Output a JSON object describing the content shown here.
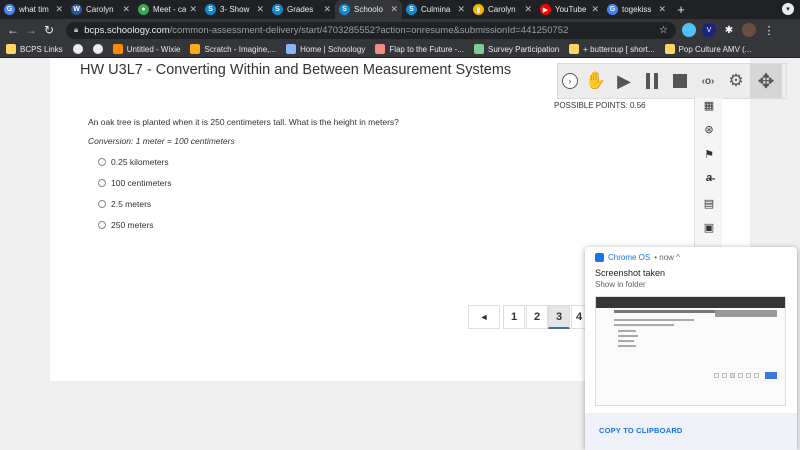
{
  "browser": {
    "tabs": [
      {
        "label": "what tim",
        "favicon": "G",
        "color": "#4285f4"
      },
      {
        "label": "Carolyn",
        "favicon": "W",
        "color": "#2b579a"
      },
      {
        "label": "Meet - ca",
        "favicon": "●",
        "color": "#34a853"
      },
      {
        "label": "3- Show",
        "favicon": "S",
        "color": "#0c8bd1"
      },
      {
        "label": "Grades",
        "favicon": "S",
        "color": "#0c8bd1"
      },
      {
        "label": "Schoolo",
        "favicon": "S",
        "color": "#0c8bd1",
        "active": true
      },
      {
        "label": "Culmina",
        "favicon": "S",
        "color": "#0c8bd1"
      },
      {
        "label": "Carolyn",
        "favicon": "▮",
        "color": "#f4b400"
      },
      {
        "label": "YouTube",
        "favicon": "▶",
        "color": "#ff0000"
      },
      {
        "label": "togekiss",
        "favicon": "G",
        "color": "#4285f4"
      }
    ],
    "new_tab": "+",
    "url_host": "bcps.schoology.com",
    "url_path": "/common-assessment-delivery/start/4703285552?action=onresume&submissionId=441250752",
    "bookmarks": [
      {
        "label": "BCPS Links",
        "color": "#fdd663"
      },
      {
        "label": "",
        "color": "#e8eaed"
      },
      {
        "label": "",
        "color": "#e8eaed"
      },
      {
        "label": "Untitled - Wixie",
        "color": "#ff8a00"
      },
      {
        "label": "Scratch - Imagine,...",
        "color": "#ffab19"
      },
      {
        "label": "Home | Schoology",
        "color": "#8ab4f8"
      },
      {
        "label": "Flap to the Future -...",
        "color": "#f28b82"
      },
      {
        "label": "Survey Participation",
        "color": "#81c995"
      },
      {
        "label": "+ buttercup [ short...",
        "color": "#fdd663"
      },
      {
        "label": "Pop Culture AMV (...",
        "color": "#fdd663"
      }
    ]
  },
  "assessment": {
    "title": "HW U3L7 - Converting Within and Between Measurement Systems",
    "possible_points": "POSSIBLE POINTS: 0.56",
    "question": "An oak tree is planted when it is 250 centimeters tall. What is the height in meters?",
    "conversion": "Conversion: 1 meter = 100 centimeters",
    "options": [
      "0.25 kilometers",
      "100 centimeters",
      "2.5 meters",
      "250 meters"
    ],
    "pager": {
      "prev": "◄",
      "pages": [
        "1",
        "2",
        "3",
        "4"
      ],
      "current": "3"
    }
  },
  "tools": {
    "collapse": "›",
    "pointer": "✋",
    "play": "▶",
    "speech": "‹o›",
    "settings": "⚙",
    "drag": "✥"
  },
  "sidebar_icons": [
    "calculator-grid-icon",
    "accessibility-icon",
    "flag-icon",
    "strikethrough-icon",
    "calculator-icon",
    "notepad-icon"
  ],
  "notification": {
    "source": "Chrome OS",
    "time": "• now ^",
    "title": "Screenshot taken",
    "subtitle": "Show in folder",
    "action": "COPY TO CLIPBOARD"
  }
}
